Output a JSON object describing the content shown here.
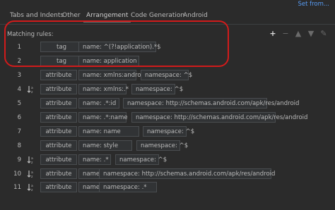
{
  "header": {
    "set_from": "Set from..."
  },
  "tabs": [
    {
      "label": "Tabs and Indents"
    },
    {
      "label": "Other"
    },
    {
      "label": "Arrangement"
    },
    {
      "label": "Code Generation"
    },
    {
      "label": "Android"
    }
  ],
  "active_tab": "Arrangement",
  "panel": {
    "title": "Matching rules:"
  },
  "toolbar": {
    "add": "+",
    "remove": "−",
    "up": "▲",
    "down": "▼",
    "edit": "✎"
  },
  "rules": [
    {
      "index": "1",
      "sort": false,
      "kind": "tag",
      "name": "name: ^(?!application).*$",
      "namespace": ""
    },
    {
      "index": "2",
      "sort": false,
      "kind": "tag",
      "name": "name: application",
      "namespace": ""
    },
    {
      "index": "3",
      "sort": false,
      "kind": "attribute",
      "name": "name: xmlns:android",
      "namespace": "namespace: ^$"
    },
    {
      "index": "4",
      "sort": true,
      "kind": "attribute",
      "name": "name: xmlns:.*",
      "namespace": "namespace: ^$"
    },
    {
      "index": "5",
      "sort": false,
      "kind": "attribute",
      "name": "name: .*:id",
      "namespace": "namespace: http://schemas.android.com/apk/res/android"
    },
    {
      "index": "6",
      "sort": false,
      "kind": "attribute",
      "name": "name: .*:name",
      "namespace": "namespace: http://schemas.android.com/apk/res/android"
    },
    {
      "index": "7",
      "sort": false,
      "kind": "attribute",
      "name": "name: name",
      "namespace": "namespace: ^$"
    },
    {
      "index": "8",
      "sort": false,
      "kind": "attribute",
      "name": "name: style",
      "namespace": "namespace: ^$"
    },
    {
      "index": "9",
      "sort": true,
      "kind": "attribute",
      "name": "name: .*",
      "namespace": "namespace: ^$"
    },
    {
      "index": "10",
      "sort": true,
      "kind": "attribute",
      "name": "name: .*",
      "namespace": "namespace: http://schemas.android.com/apk/res/android"
    },
    {
      "index": "11",
      "sort": true,
      "kind": "attribute",
      "name": "name: .*",
      "namespace": "namespace: .*"
    }
  ],
  "colors": {
    "background": "#2b2b2b",
    "highlight": "#d11b1b",
    "link": "#589df6"
  },
  "icons": {
    "sort_icon": "sort-alphabetical-icon"
  }
}
